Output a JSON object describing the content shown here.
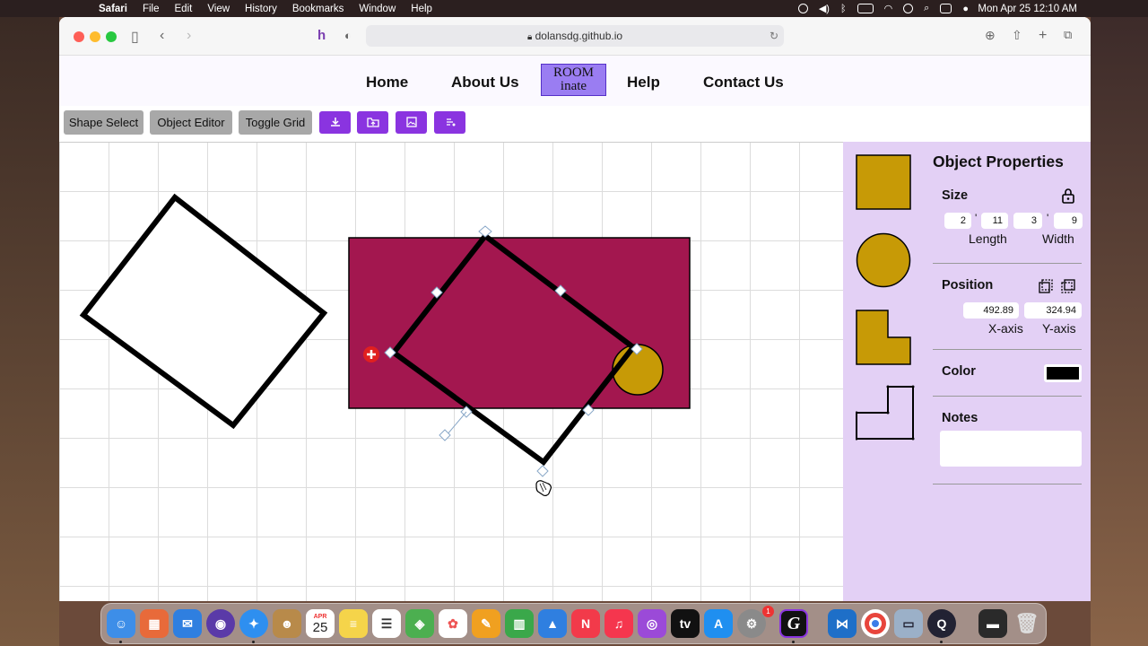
{
  "menubar": {
    "app": "Safari",
    "items": [
      "File",
      "Edit",
      "View",
      "History",
      "Bookmarks",
      "Window",
      "Help"
    ],
    "clock": "Mon Apr 25  12:10 AM"
  },
  "browser": {
    "url": "dolansdg.github.io"
  },
  "nav": {
    "home": "Home",
    "about": "About Us",
    "logo_line1": "ROOM",
    "logo_line2": "inate",
    "help": "Help",
    "contact": "Contact Us"
  },
  "toolbar": {
    "shape_select": "Shape Select",
    "object_editor": "Object Editor",
    "toggle_grid": "Toggle Grid",
    "icons": [
      "download-icon",
      "upload-folder-icon",
      "image-icon",
      "share-icon"
    ]
  },
  "properties": {
    "title": "Object Properties",
    "size_label": "Size",
    "length_ft": "2",
    "length_in": "11",
    "width_ft": "3",
    "width_in": "9",
    "length_label": "Length",
    "width_label": "Width",
    "position_label": "Position",
    "x_value": "492.89",
    "y_value": "324.94",
    "x_label": "X-axis",
    "y_label": "Y-axis",
    "color_label": "Color",
    "color_value": "#000000",
    "notes_label": "Notes",
    "notes_value": ""
  },
  "shapes_palette": [
    "square",
    "circle",
    "l-shape-filled",
    "l-shape-outline"
  ],
  "colors": {
    "accent_purple": "#8a34e0",
    "panel_bg": "#e3d0f5",
    "rug_magenta": "#a3174f",
    "shape_gold": "#c79a06"
  },
  "dock": {
    "calendar_month": "APR",
    "calendar_day": "25",
    "badge": "1"
  }
}
